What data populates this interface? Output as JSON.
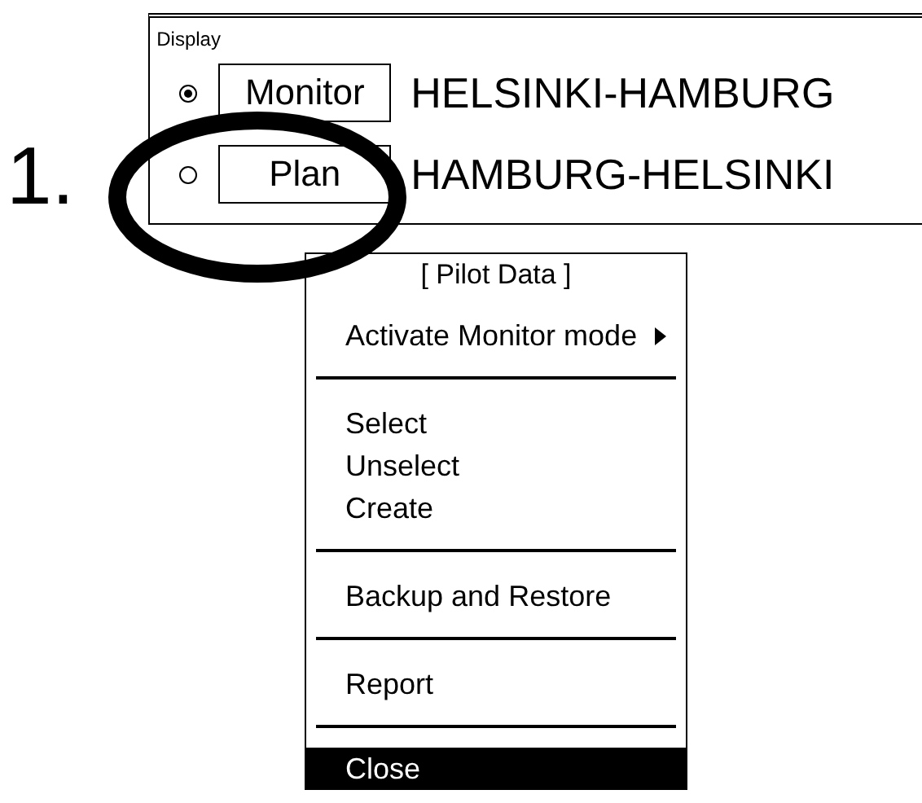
{
  "step_label": "1.",
  "display": {
    "title": "Display",
    "routes": [
      {
        "button": "Monitor",
        "route": "HELSINKI-HAMBURG",
        "selected": true
      },
      {
        "button": "Plan",
        "route": "HAMBURG-HELSINKI",
        "selected": false
      }
    ]
  },
  "menu": {
    "title": "[ Pilot Data ]",
    "groups": [
      [
        {
          "label": "Activate Monitor mode",
          "submenu": true,
          "selected": false
        }
      ],
      [
        {
          "label": "Select",
          "submenu": false,
          "selected": false
        },
        {
          "label": "Unselect",
          "submenu": false,
          "selected": false
        },
        {
          "label": "Create",
          "submenu": false,
          "selected": false
        }
      ],
      [
        {
          "label": "Backup and Restore",
          "submenu": false,
          "selected": false
        }
      ],
      [
        {
          "label": "Report",
          "submenu": false,
          "selected": false
        }
      ],
      [
        {
          "label": "Close",
          "submenu": false,
          "selected": true
        }
      ]
    ]
  }
}
